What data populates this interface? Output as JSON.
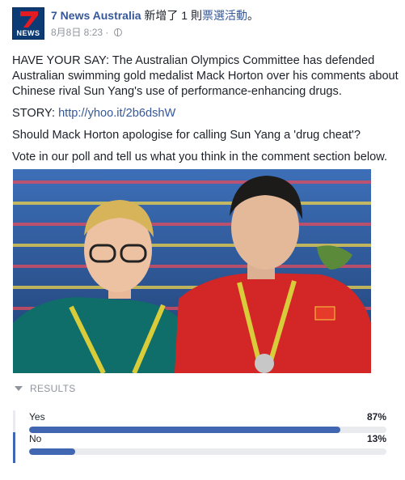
{
  "post": {
    "page_name": "7 News Australia",
    "action": "新增了 1 則",
    "event_link": "票選活動",
    "action_end": "。",
    "date": "8月8日 8:23",
    "separator": "·",
    "avatar_text": "NEWS",
    "body": [
      "HAVE YOUR SAY: The Australian Olympics Committee has defended Australian swimming gold medalist Mack Horton over his comments about Chinese rival Sun Yang's use of performance-enhancing drugs.",
      "Should Mack Horton apologise for calling Sun Yang a 'drug cheat'?",
      "Vote in our poll and tell us what you think in the comment section below."
    ],
    "story_label": "STORY:",
    "story_link": "http://yhoo.it/2b6dshW"
  },
  "poll": {
    "results_label": "RESULTS",
    "options": [
      {
        "label": "Yes",
        "percent_text": "87%",
        "percent": 87,
        "selected": false
      },
      {
        "label": "No",
        "percent_text": "13%",
        "percent": 13,
        "selected": true
      }
    ]
  },
  "colors": {
    "link": "#365899",
    "bar": "#4267b2",
    "track": "#e9ebee",
    "meta": "#90949c"
  }
}
